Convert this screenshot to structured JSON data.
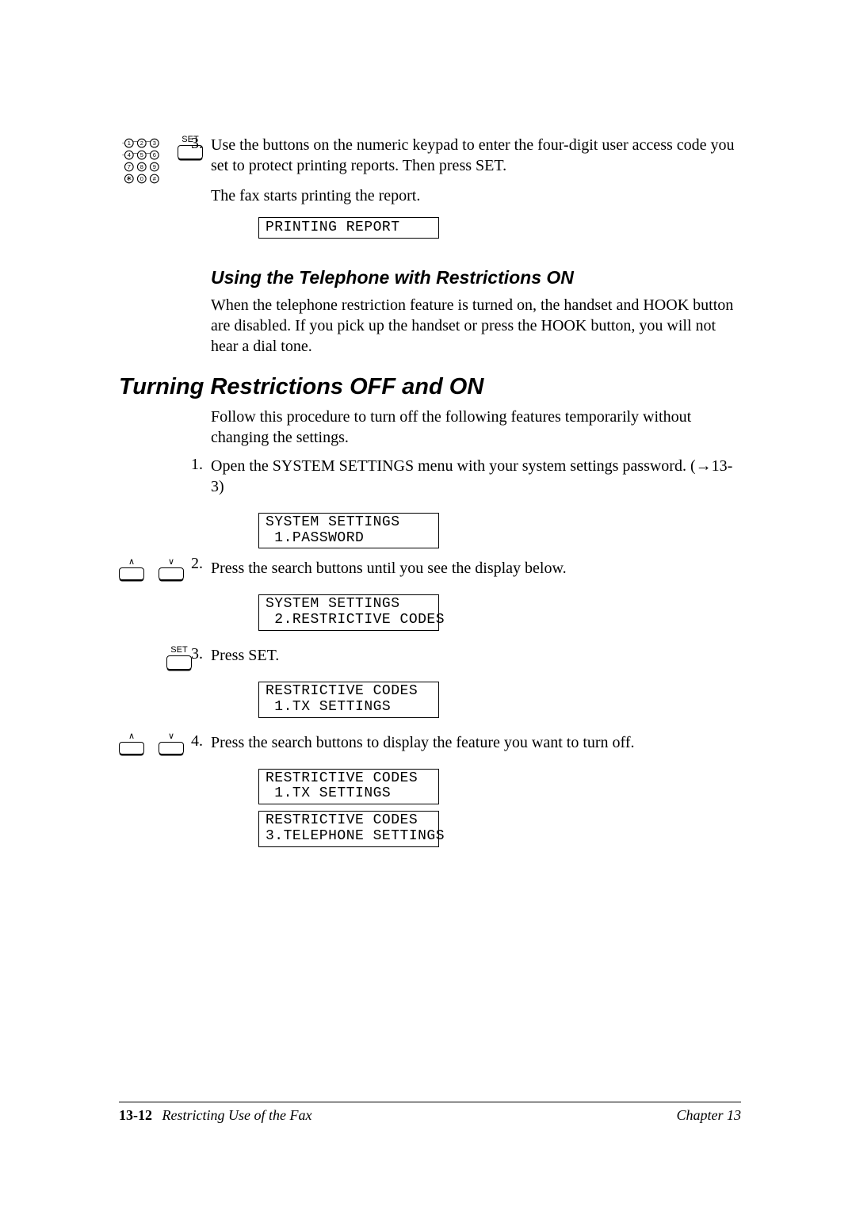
{
  "icons": {
    "set_label": "SET"
  },
  "step3_top": {
    "num": "3.",
    "text": "Use the buttons on the numeric keypad to enter the four-digit user access code you set to protect printing reports. Then press SET.",
    "sub": "The fax starts printing the report.",
    "lcd": "PRINTING REPORT"
  },
  "sub_heading": "Using the Telephone with Restrictions ON",
  "sub_para": "When the telephone restriction feature is turned on, the handset and HOOK button are disabled. If you pick up the handset or press the HOOK button, you will not hear a dial tone.",
  "main_heading": "Turning Restrictions OFF and ON",
  "main_para": "Follow this procedure to turn off the following features temporarily without changing the settings.",
  "step1": {
    "num": "1.",
    "text": "Open the SYSTEM SETTINGS menu with your system settings password. (→13-3)",
    "lcd": "SYSTEM SETTINGS\n 1.PASSWORD"
  },
  "step2": {
    "num": "2.",
    "text": "Press the search buttons until you see the display below.",
    "lcd": "SYSTEM SETTINGS\n 2.RESTRICTIVE CODES"
  },
  "step3": {
    "num": "3.",
    "text": "Press SET.",
    "lcd": "RESTRICTIVE CODES\n 1.TX SETTINGS"
  },
  "step4": {
    "num": "4.",
    "text": "Press the search buttons to display the feature you want to turn off.",
    "lcd1": "RESTRICTIVE CODES\n 1.TX SETTINGS",
    "lcd2": "RESTRICTIVE CODES\n3.TELEPHONE SETTINGS"
  },
  "footer": {
    "page": "13-12",
    "title": "Restricting Use of the Fax",
    "chapter": "Chapter 13"
  }
}
